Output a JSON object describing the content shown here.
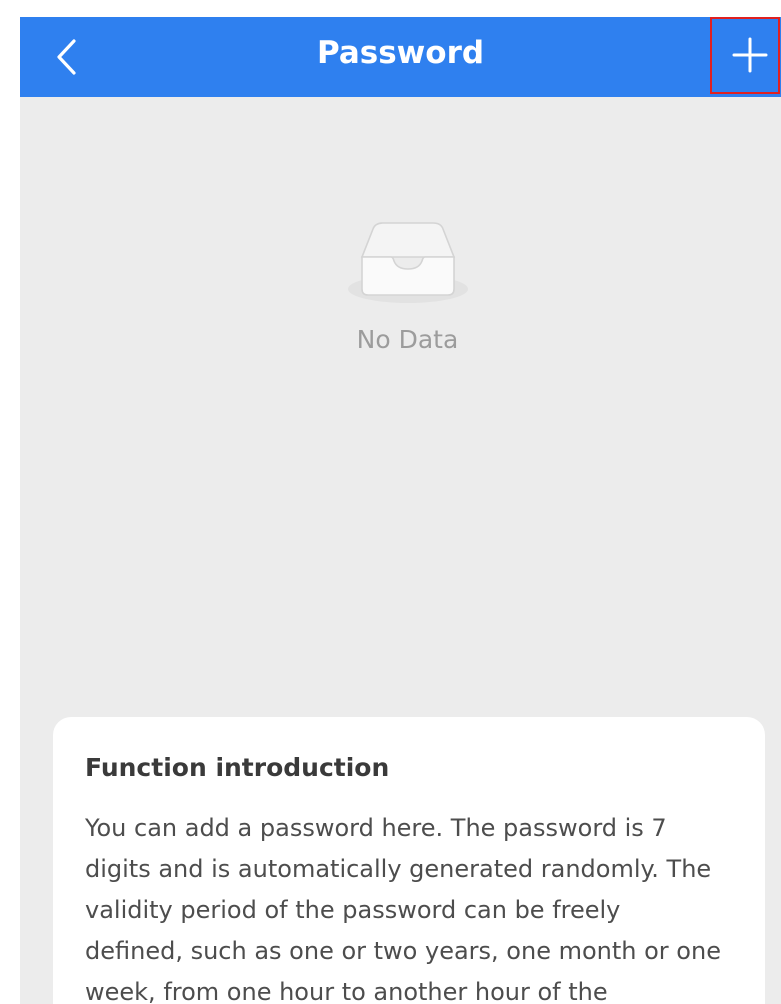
{
  "header": {
    "title": "Password",
    "back_icon": "chevron-left-icon",
    "add_icon": "plus-icon",
    "background_color": "#2f80ef",
    "highlight_color": "#e02020"
  },
  "empty_state": {
    "icon": "inbox-tray-icon",
    "text": "No Data"
  },
  "intro": {
    "title": "Function introduction",
    "body": "You can add a password here. The password is 7 digits and is automatically generated randomly. The validity period of the password can be freely defined, such as one or two years, one month or one week, from one hour to another hour of the"
  }
}
